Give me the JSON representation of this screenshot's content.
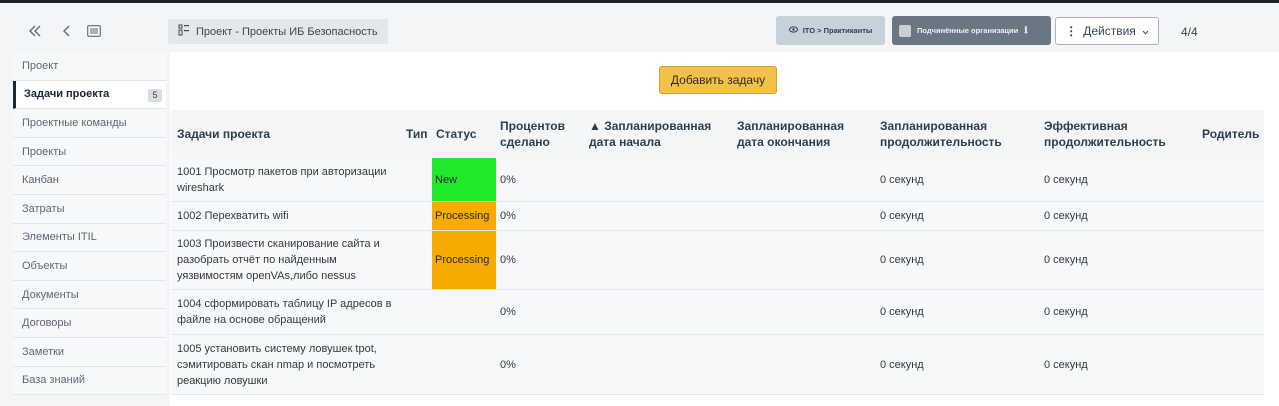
{
  "header": {
    "breadcrumb": "Проект - Проекты ИБ Безопасность",
    "ito_button": "ITO > Практиканты",
    "subordinate_button": "Подчинённые организации",
    "actions_button": "Действия",
    "page_count": "4/4",
    "icons": [
      "double-chevron-left-icon",
      "chevron-left-icon",
      "list-icon",
      "project-icon",
      "eye-icon",
      "info-icon",
      "kebab-icon",
      "chevron-down-icon"
    ]
  },
  "sidebar": {
    "items": [
      {
        "label": "Проект"
      },
      {
        "label": "Задачи проекта",
        "badge": "5"
      },
      {
        "label": "Проектные команды"
      },
      {
        "label": "Проекты"
      },
      {
        "label": "Канбан"
      },
      {
        "label": "Затраты"
      },
      {
        "label": "Элементы ITIL"
      },
      {
        "label": "Объекты"
      },
      {
        "label": "Документы"
      },
      {
        "label": "Договоры"
      },
      {
        "label": "Заметки"
      },
      {
        "label": "База знаний"
      }
    ]
  },
  "main": {
    "add_button": "Добавить задачу",
    "columns": [
      {
        "label": "Задачи проекта"
      },
      {
        "label": "Тип"
      },
      {
        "label": "Статус"
      },
      {
        "label": "Процентов сделано"
      },
      {
        "label": "▲ Запланированная дата начала"
      },
      {
        "label": "Запланированная дата окончания"
      },
      {
        "label": "Запланированная продолжительность"
      },
      {
        "label": "Эффективная продолжительность"
      },
      {
        "label": "Родитель"
      }
    ],
    "rows": [
      {
        "task": "1001 Просмотр пакетов при авторизации wireshark",
        "status": "New",
        "status_color": "#22e82c",
        "percent": "0%",
        "planned_duration": "0 секунд",
        "effective_duration": "0 секунд"
      },
      {
        "task": "1002 Перехватить wifi",
        "status": "Processing",
        "status_color": "#f5ab00",
        "percent": "0%",
        "planned_duration": "0 секунд",
        "effective_duration": "0 секунд"
      },
      {
        "task": "1003 Произвести сканирование сайта и разобрать отчёт по найденным уязвимостям openVAs,либо nessus",
        "status": "Processing",
        "status_color": "#f5ab00",
        "percent": "0%",
        "planned_duration": "0 секунд",
        "effective_duration": "0 секунд"
      },
      {
        "task": "1004 сформировать таблицу IP адресов в файле на основе обращений",
        "status": "",
        "status_color": "",
        "percent": "0%",
        "planned_duration": "0 секунд",
        "effective_duration": "0 секунд"
      },
      {
        "task": "1005 установить систему ловушек tpot, сэмитировать скан nmap и посмотреть реакцию ловушки",
        "status": "",
        "status_color": "",
        "percent": "0%",
        "planned_duration": "0 секунд",
        "effective_duration": "0 секунд"
      }
    ]
  }
}
